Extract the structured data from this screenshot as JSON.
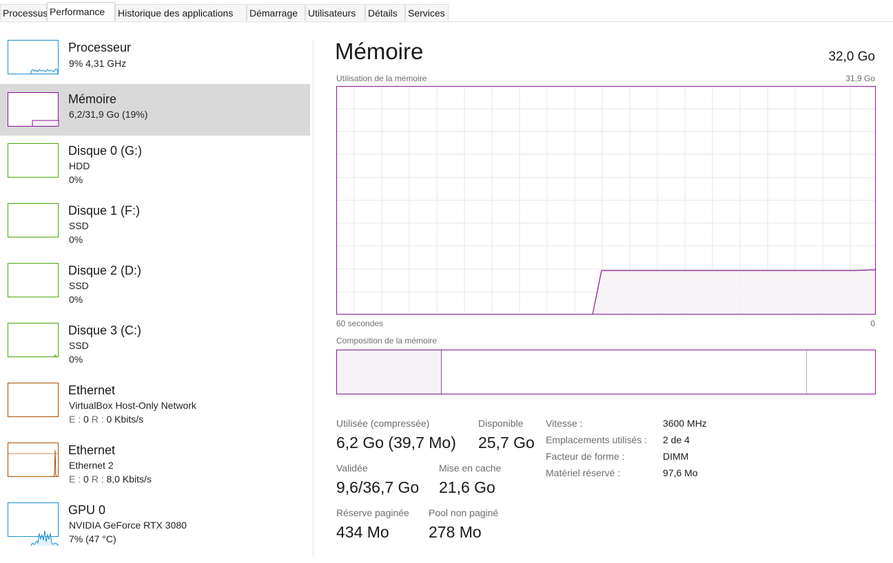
{
  "tabs": [
    "Processus",
    "Performance",
    "Historique des applications",
    "Démarrage",
    "Utilisateurs",
    "Détails",
    "Services"
  ],
  "active_tab": "Performance",
  "sidebar": {
    "items": [
      {
        "title": "Processeur",
        "line1": "9%  4,31 GHz",
        "line2": "",
        "color": "#1a8fd1",
        "icon": "cpu-graph"
      },
      {
        "title": "Mémoire",
        "line1": "6,2/31,9 Go (19%)",
        "line2": "",
        "color": "#8b129b",
        "icon": "memory-graph",
        "selected": true
      },
      {
        "title": "Disque 0 (G:)",
        "line1": "HDD",
        "line2": "0%",
        "color": "#4da60c",
        "icon": "disk-graph"
      },
      {
        "title": "Disque 1 (F:)",
        "line1": "SSD",
        "line2": "0%",
        "color": "#4da60c",
        "icon": "disk-graph"
      },
      {
        "title": "Disque 2 (D:)",
        "line1": "SSD",
        "line2": "0%",
        "color": "#4da60c",
        "icon": "disk-graph"
      },
      {
        "title": "Disque 3 (C:)",
        "line1": "SSD",
        "line2": "0%",
        "color": "#4da60c",
        "icon": "disk-graph"
      },
      {
        "title": "Ethernet",
        "line1": "VirtualBox Host-Only Network",
        "line2_e": "E :",
        "line2_e_val": " 0 ",
        "line2_r": "R :",
        "line2_r_val": " 0 Kbits/s",
        "color": "#a74f01",
        "icon": "network-graph"
      },
      {
        "title": "Ethernet",
        "line1": "Ethernet 2",
        "line2_e": "E :",
        "line2_e_val": " 0 ",
        "line2_r": "R :",
        "line2_r_val": " 8,0 Kbits/s",
        "color": "#a74f01",
        "icon": "network-graph"
      },
      {
        "title": "GPU 0",
        "line1": "NVIDIA GeForce RTX 3080",
        "line2": "7%  (47 °C)",
        "color": "#1a8fd1",
        "icon": "gpu-graph"
      }
    ]
  },
  "main": {
    "title": "Mémoire",
    "total": "32,0 Go",
    "usage_label": "Utilisation de la mémoire",
    "usage_max": "31,9 Go",
    "axis_left": "60 secondes",
    "axis_right": "0",
    "composition_label": "Composition de la mémoire",
    "stats": {
      "used_label": "Utilisée (compressée)",
      "used_value": "6,2 Go (39,7 Mo)",
      "available_label": "Disponible",
      "available_value": "25,7 Go",
      "committed_label": "Validée",
      "committed_value": "9,6/36,7 Go",
      "cached_label": "Mise en cache",
      "cached_value": "21,6 Go",
      "paged_label": "Réserve paginée",
      "paged_value": "434 Mo",
      "nonpaged_label": "Pool non paginé",
      "nonpaged_value": "278 Mo"
    },
    "specs": [
      {
        "label": "Vitesse :",
        "value": "3600 MHz"
      },
      {
        "label": "Emplacements utilisés :",
        "value": "2 de 4"
      },
      {
        "label": "Facteur de forme :",
        "value": "DIMM"
      },
      {
        "label": "Matériel réservé :",
        "value": "97,6 Mo"
      }
    ],
    "accent": "#8b129b"
  }
}
